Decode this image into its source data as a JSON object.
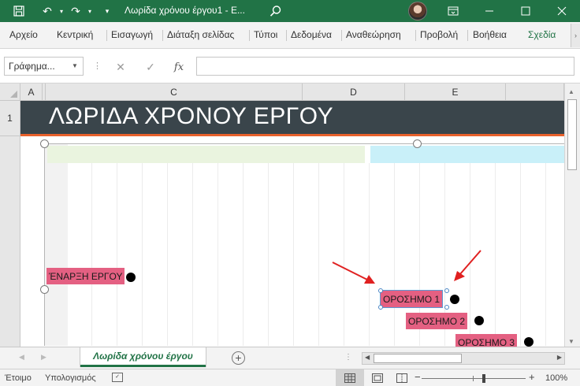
{
  "titlebar": {
    "title": "Λωρίδα χρόνου έργου1  -  E...",
    "icons": [
      "save-icon",
      "undo-icon",
      "redo-icon",
      "search-icon",
      "ribbon-display-icon",
      "minimize-icon",
      "maximize-icon",
      "close-icon"
    ]
  },
  "ribbon": {
    "tabs": [
      "Αρχείο",
      "Κεντρική",
      "Εισαγωγή",
      "Διάταξη σελίδας",
      "Τύποι",
      "Δεδομένα",
      "Αναθεώρηση",
      "Προβολή",
      "Βοήθεια",
      "Σχεδία"
    ]
  },
  "formula_bar": {
    "name_box": "Γράφημα...",
    "value": ""
  },
  "columns": [
    "A",
    "C",
    "D",
    "E"
  ],
  "rows": [
    "1"
  ],
  "sheet": {
    "banner_title": "ΛΩΡΙΔΑ ΧΡΟΝΟΥ ΕΡΓΟΥ",
    "milestones": [
      "ΈΝΑΡΞΗ ΕΡΓΟΥ",
      "ΟΡΟΣΗΜΟ 1",
      "ΟΡΟΣΗΜΟ 2",
      "ΟΡΟΣΗΜΟ 3"
    ]
  },
  "tabs": {
    "sheet_name": "Λωρίδα χρόνου έργου"
  },
  "status": {
    "ready": "Έτοιμο",
    "calc": "Υπολογισμός",
    "zoom": "100%"
  },
  "colors": {
    "accent": "#217346",
    "banner": "#3a454b",
    "banner_line": "#e8612c",
    "milestone": "#e46082",
    "arrow": "#e02020"
  }
}
